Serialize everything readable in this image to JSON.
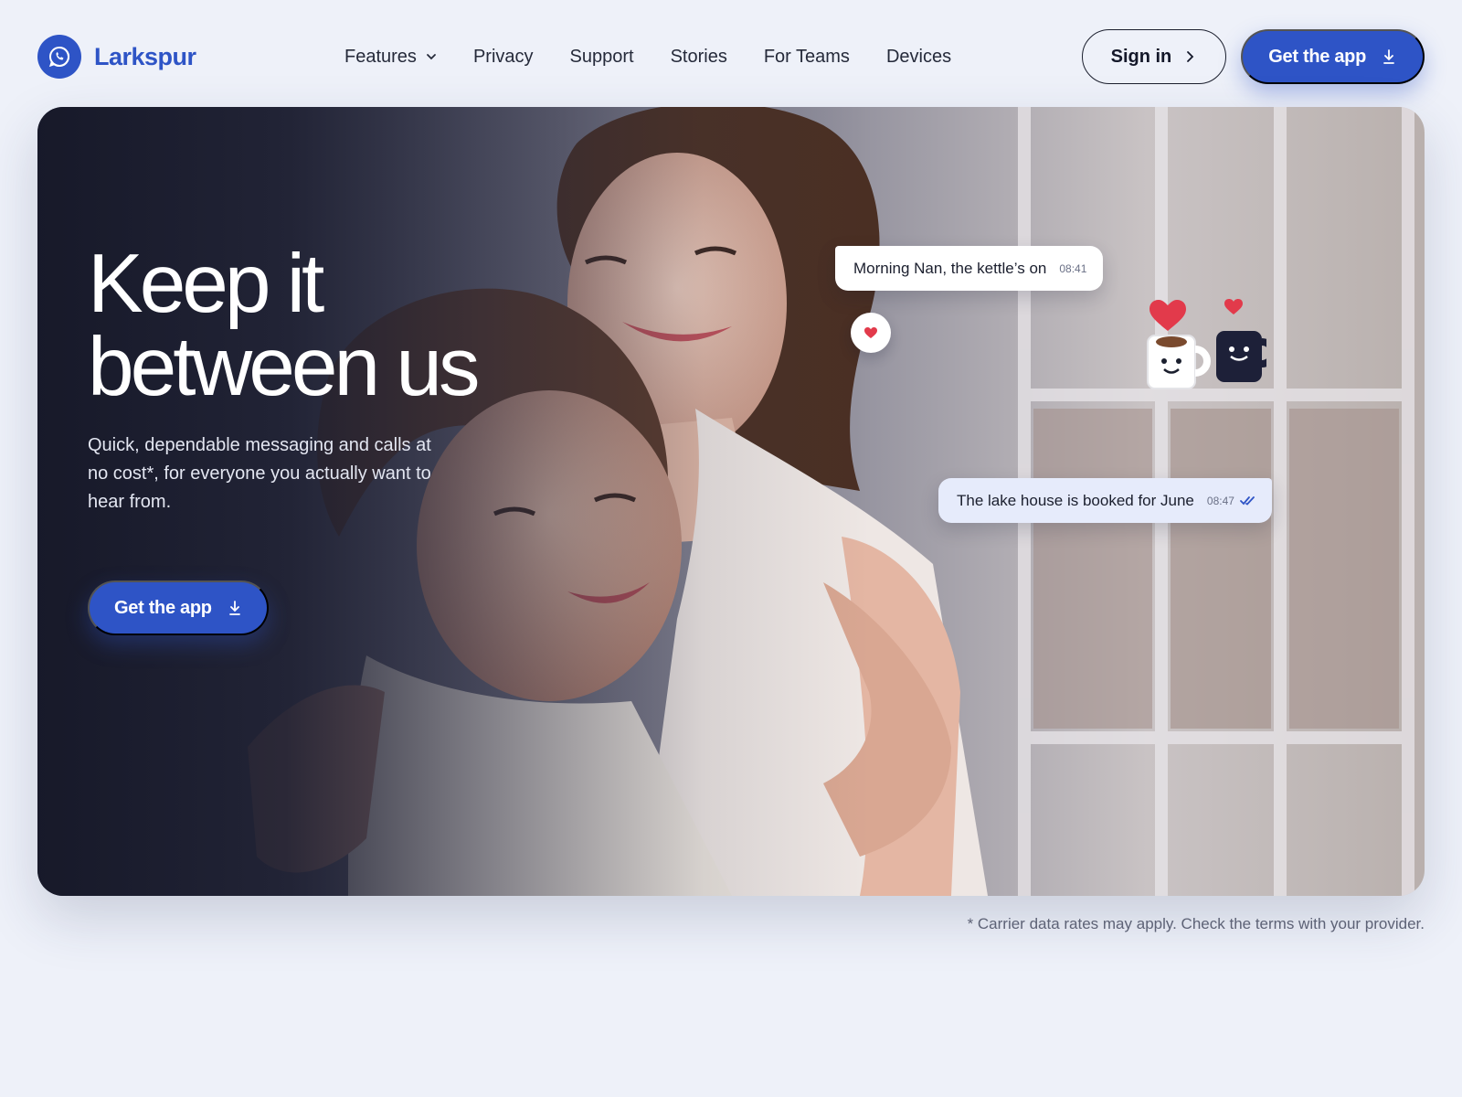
{
  "brand": {
    "name": "Larkspur"
  },
  "nav": {
    "items": [
      {
        "label": "Features",
        "has_dropdown": true
      },
      {
        "label": "Privacy"
      },
      {
        "label": "Support"
      },
      {
        "label": "Stories"
      },
      {
        "label": "For Teams"
      },
      {
        "label": "Devices"
      }
    ]
  },
  "header": {
    "signin_label": "Sign in",
    "get_app_label": "Get the app"
  },
  "hero": {
    "title_line1": "Keep it",
    "title_line2": "between us",
    "subtitle": "Quick, dependable messaging and calls at no cost*, for everyone you actually want to hear from.",
    "cta_label": "Get the app"
  },
  "chat": {
    "incoming": {
      "text": "Morning Nan, the kettle’s on",
      "time": "08:41"
    },
    "outgoing": {
      "text": "The lake house is booked for June",
      "time": "08:47",
      "read": true
    },
    "reaction_icon": "heart-icon"
  },
  "footnote": "* Carrier data rates may apply. Check the terms with your provider.",
  "colors": {
    "accent": "#2e54c6",
    "page_bg": "#eef1f9",
    "heart": "#e23a4b"
  }
}
